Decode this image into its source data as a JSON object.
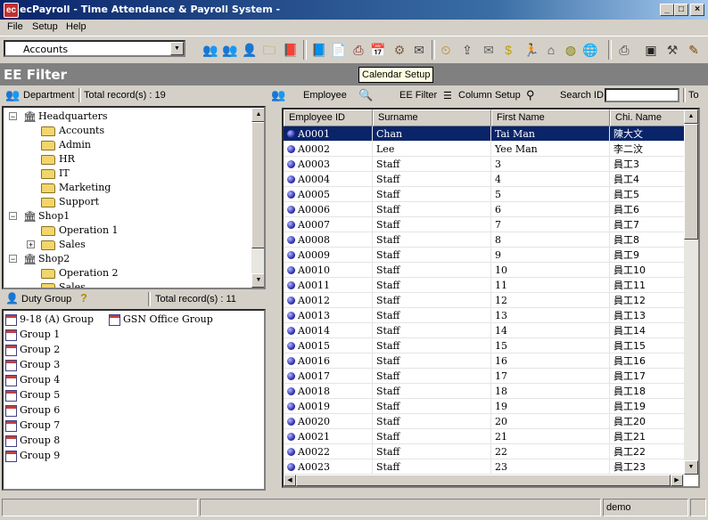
{
  "window": {
    "title": "ecPayroll - Time Attendance & Payroll System -"
  },
  "menu": [
    "File",
    "Setup",
    "Help"
  ],
  "toolbar": {
    "combo_value": "Accounts",
    "icons": [
      "employees-icon",
      "group-icon",
      "person-icon",
      "folder-icon",
      "book-icon",
      "ledger-icon",
      "report-icon",
      "printer-icon",
      "calendar-setup-icon",
      "settings-gear-icon",
      "leave-icon",
      "clock-icon",
      "export-icon",
      "mail-icon",
      "money-icon",
      "runner-icon",
      "home-icon",
      "globe-icon",
      "world-icon",
      "printer2-icon",
      "monitor-icon",
      "tool-icon",
      "wrench-icon",
      "exit-icon"
    ]
  },
  "header": {
    "title": "EE Filter",
    "tooltip": "Calendar Setup"
  },
  "dept": {
    "label": "Department",
    "count": "Total record(s) : 19"
  },
  "tree": [
    {
      "label": "Headquarters",
      "type": "building",
      "level": 0,
      "expander": "−"
    },
    {
      "label": "Accounts",
      "type": "folder",
      "level": 1
    },
    {
      "label": "Admin",
      "type": "folder",
      "level": 1
    },
    {
      "label": "HR",
      "type": "folder",
      "level": 1
    },
    {
      "label": "IT",
      "type": "folder",
      "level": 1
    },
    {
      "label": "Marketing",
      "type": "folder",
      "level": 1
    },
    {
      "label": "Support",
      "type": "folder",
      "level": 1
    },
    {
      "label": "Shop1",
      "type": "building",
      "level": 0,
      "expander": "−"
    },
    {
      "label": "Operation 1",
      "type": "folder",
      "level": 1
    },
    {
      "label": "Sales",
      "type": "folder",
      "level": 1,
      "expander": "+"
    },
    {
      "label": "Shop2",
      "type": "building",
      "level": 0,
      "expander": "−"
    },
    {
      "label": "Operation 2",
      "type": "folder",
      "level": 1
    },
    {
      "label": "Sales",
      "type": "folder",
      "level": 1
    }
  ],
  "duty": {
    "label": "Duty Group",
    "count": "Total record(s) : 11"
  },
  "groups": [
    "9-18 (A) Group",
    "GSN Office Group",
    "Group 1",
    "Group 2",
    "Group 3",
    "Group 4",
    "Group 5",
    "Group 6",
    "Group 7",
    "Group 8",
    "Group 9"
  ],
  "emp_bar": {
    "employee": "Employee",
    "filter": "EE Filter",
    "column_setup": "Column Setup",
    "search_label": "Search ID",
    "search_value": "",
    "to_label": "To"
  },
  "grid": {
    "columns": [
      "Employee ID",
      "Surname",
      "First Name",
      "Chi. Name"
    ],
    "rows": [
      [
        "A0001",
        "Chan",
        "Tai Man",
        "陳大文"
      ],
      [
        "A0002",
        "Lee",
        "Yee Man",
        "李二汶"
      ],
      [
        "A0003",
        "Staff",
        "3",
        "員工3"
      ],
      [
        "A0004",
        "Staff",
        "4",
        "員工4"
      ],
      [
        "A0005",
        "Staff",
        "5",
        "員工5"
      ],
      [
        "A0006",
        "Staff",
        "6",
        "員工6"
      ],
      [
        "A0007",
        "Staff",
        "7",
        "員工7"
      ],
      [
        "A0008",
        "Staff",
        "8",
        "員工8"
      ],
      [
        "A0009",
        "Staff",
        "9",
        "員工9"
      ],
      [
        "A0010",
        "Staff",
        "10",
        "員工10"
      ],
      [
        "A0011",
        "Staff",
        "11",
        "員工11"
      ],
      [
        "A0012",
        "Staff",
        "12",
        "員工12"
      ],
      [
        "A0013",
        "Staff",
        "13",
        "員工13"
      ],
      [
        "A0014",
        "Staff",
        "14",
        "員工14"
      ],
      [
        "A0015",
        "Staff",
        "15",
        "員工15"
      ],
      [
        "A0016",
        "Staff",
        "16",
        "員工16"
      ],
      [
        "A0017",
        "Staff",
        "17",
        "員工17"
      ],
      [
        "A0018",
        "Staff",
        "18",
        "員工18"
      ],
      [
        "A0019",
        "Staff",
        "19",
        "員工19"
      ],
      [
        "A0020",
        "Staff",
        "20",
        "員工20"
      ],
      [
        "A0021",
        "Staff",
        "21",
        "員工21"
      ],
      [
        "A0022",
        "Staff",
        "22",
        "員工22"
      ],
      [
        "A0023",
        "Staff",
        "23",
        "員工23"
      ]
    ],
    "selected_row": 0
  },
  "status": {
    "user": "demo"
  }
}
